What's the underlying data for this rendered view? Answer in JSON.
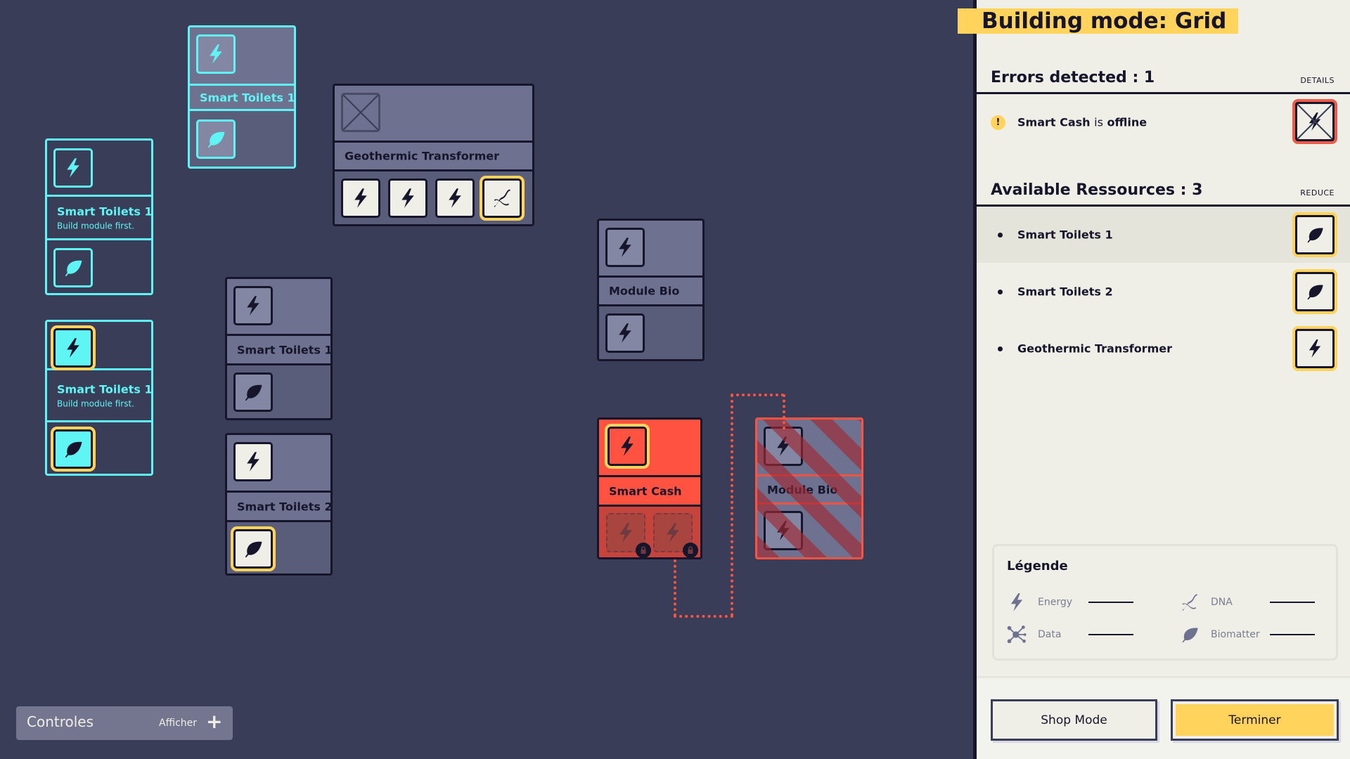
{
  "colors": {
    "background": "#3a3d57",
    "accent_cyan": "#5ff5f5",
    "accent_yellow": "#ffd35c",
    "error_red": "#ff5240",
    "panel": "#efefe8"
  },
  "grid": {
    "cards": [
      {
        "name": "Smart Toilets 1",
        "state": "preview"
      },
      {
        "name": "Smart Toilets 1",
        "subtitle": "Build module first.",
        "state": "ghost"
      },
      {
        "name": "Smart Toilets 1",
        "subtitle": "Build module first.",
        "state": "ghost-selected"
      },
      {
        "name": "Geothermic Transformer",
        "state": "placed"
      },
      {
        "name": "Smart Toilets 1",
        "state": "placed"
      },
      {
        "name": "Smart Toilets 2",
        "state": "placed"
      },
      {
        "name": "Module Bio",
        "state": "placed"
      },
      {
        "name": "Smart Cash",
        "state": "offline"
      },
      {
        "name": "Module Bio",
        "state": "invalid"
      }
    ]
  },
  "controls": {
    "title": "Controles",
    "action": "Afficher",
    "icon": "plus-icon"
  },
  "panel": {
    "title": "Building mode: Grid",
    "errors": {
      "heading": "Errors detected : 1",
      "action": "DETAILS",
      "items": [
        {
          "subject": "Smart Cash",
          "verb": "is",
          "state": "offline",
          "icon": "bolt-crossed-icon"
        }
      ]
    },
    "resources": {
      "heading": "Available Ressources : 3",
      "action": "REDUCE",
      "items": [
        {
          "name": "Smart Toilets 1",
          "icon": "leaf-icon"
        },
        {
          "name": "Smart Toilets 2",
          "icon": "leaf-icon"
        },
        {
          "name": "Geothermic Transformer",
          "icon": "bolt-icon"
        }
      ]
    },
    "legend": {
      "title": "Légende",
      "items": [
        {
          "label": "Energy",
          "icon": "bolt-icon"
        },
        {
          "label": "DNA",
          "icon": "dna-icon"
        },
        {
          "label": "Data",
          "icon": "data-icon"
        },
        {
          "label": "Biomatter",
          "icon": "leaf-icon"
        }
      ]
    },
    "buttons": {
      "shop": "Shop Mode",
      "finish": "Terminer"
    }
  }
}
